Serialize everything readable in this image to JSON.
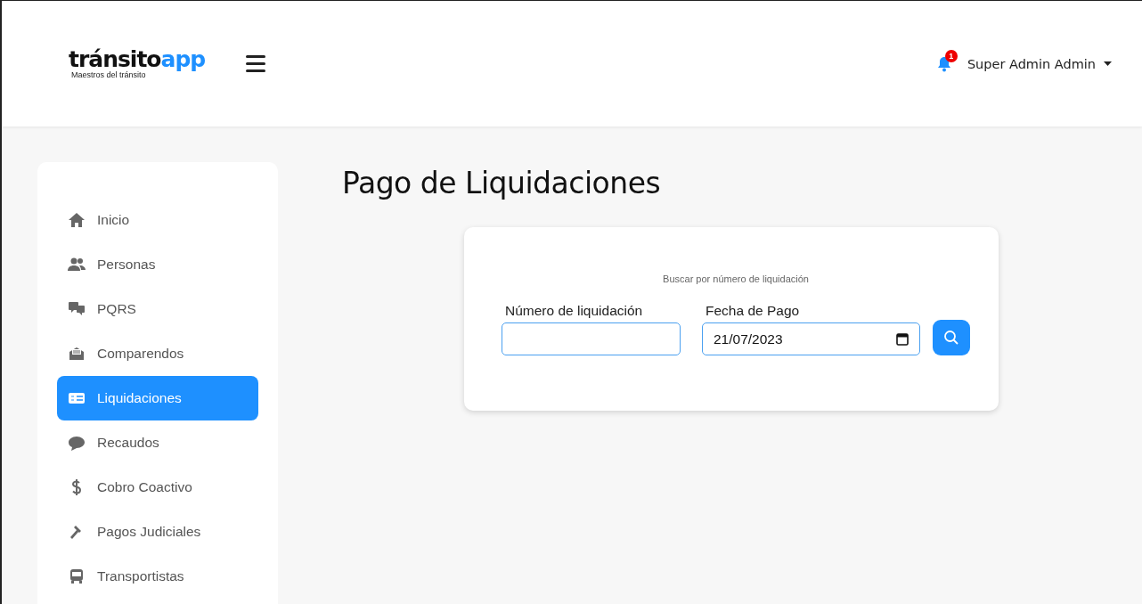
{
  "header": {
    "logo": {
      "word": "tránsito",
      "accent": "app",
      "tagline": "Maestros del tránsito"
    },
    "notifications": {
      "count": "1"
    },
    "user": {
      "name": "Super Admin Admin"
    }
  },
  "sidebar": {
    "items": [
      {
        "label": "Inicio",
        "selected": false
      },
      {
        "label": "Personas",
        "selected": false
      },
      {
        "label": "PQRS",
        "selected": false
      },
      {
        "label": "Comparendos",
        "selected": false
      },
      {
        "label": "Liquidaciones",
        "selected": true
      },
      {
        "label": "Recaudos",
        "selected": false
      },
      {
        "label": "Cobro Coactivo",
        "selected": false
      },
      {
        "label": "Pagos Judiciales",
        "selected": false
      },
      {
        "label": "Transportistas",
        "selected": false
      }
    ]
  },
  "page": {
    "title": "Pago de Liquidaciones"
  },
  "search_card": {
    "hint": "Buscar por número de liquidación",
    "fields": [
      {
        "label": "Número de liquidación",
        "kind": "text"
      },
      {
        "label": "Fecha de Pago",
        "kind": "date",
        "value": "21/07/2023"
      }
    ]
  }
}
